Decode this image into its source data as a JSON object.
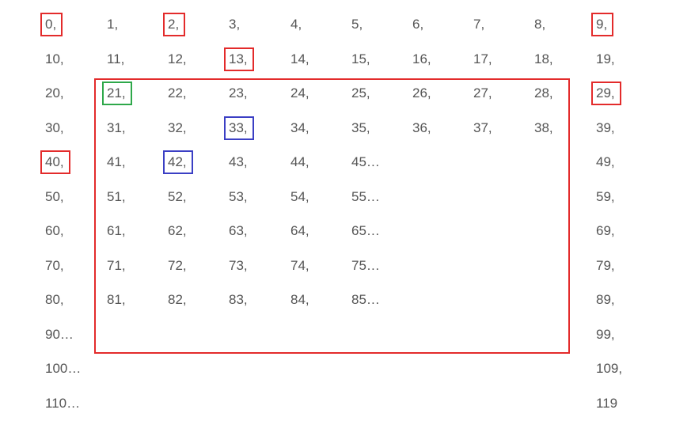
{
  "colors": {
    "text": "#555555",
    "red": "#e32b2b",
    "green": "#2ea84a",
    "blue": "#3b3fc4"
  },
  "rows": [
    {
      "cells": [
        {
          "col": 0,
          "text": "0,"
        },
        {
          "col": 1,
          "text": "1,"
        },
        {
          "col": 2,
          "text": "2,"
        },
        {
          "col": 3,
          "text": "3,"
        },
        {
          "col": 4,
          "text": "4,"
        },
        {
          "col": 5,
          "text": "5,"
        },
        {
          "col": 6,
          "text": "6,"
        },
        {
          "col": 7,
          "text": "7,"
        },
        {
          "col": 8,
          "text": "8,"
        },
        {
          "col": 9,
          "text": "9,"
        }
      ]
    },
    {
      "cells": [
        {
          "col": 0,
          "text": "10,"
        },
        {
          "col": 1,
          "text": "11,"
        },
        {
          "col": 2,
          "text": "12,"
        },
        {
          "col": 3,
          "text": "13,"
        },
        {
          "col": 4,
          "text": "14,"
        },
        {
          "col": 5,
          "text": "15,"
        },
        {
          "col": 6,
          "text": "16,"
        },
        {
          "col": 7,
          "text": "17,"
        },
        {
          "col": 8,
          "text": "18,"
        },
        {
          "col": 9,
          "text": "19,"
        }
      ]
    },
    {
      "cells": [
        {
          "col": 0,
          "text": "20,"
        },
        {
          "col": 1,
          "text": "21,"
        },
        {
          "col": 2,
          "text": "22,"
        },
        {
          "col": 3,
          "text": "23,"
        },
        {
          "col": 4,
          "text": "24,"
        },
        {
          "col": 5,
          "text": "25,"
        },
        {
          "col": 6,
          "text": "26,"
        },
        {
          "col": 7,
          "text": "27,"
        },
        {
          "col": 8,
          "text": "28,"
        },
        {
          "col": 9,
          "text": "29,"
        }
      ]
    },
    {
      "cells": [
        {
          "col": 0,
          "text": "30,"
        },
        {
          "col": 1,
          "text": "31,"
        },
        {
          "col": 2,
          "text": "32,"
        },
        {
          "col": 3,
          "text": "33,"
        },
        {
          "col": 4,
          "text": "34,"
        },
        {
          "col": 5,
          "text": "35,"
        },
        {
          "col": 6,
          "text": "36,"
        },
        {
          "col": 7,
          "text": "37,"
        },
        {
          "col": 8,
          "text": "38,"
        },
        {
          "col": 9,
          "text": "39,"
        }
      ]
    },
    {
      "cells": [
        {
          "col": 0,
          "text": "40,"
        },
        {
          "col": 1,
          "text": "41,"
        },
        {
          "col": 2,
          "text": "42,"
        },
        {
          "col": 3,
          "text": "43,"
        },
        {
          "col": 4,
          "text": "44,"
        },
        {
          "col": 5,
          "text": "45…"
        },
        {
          "col": 9,
          "text": "49,"
        }
      ]
    },
    {
      "cells": [
        {
          "col": 0,
          "text": "50,"
        },
        {
          "col": 1,
          "text": "51,"
        },
        {
          "col": 2,
          "text": "52,"
        },
        {
          "col": 3,
          "text": "53,"
        },
        {
          "col": 4,
          "text": "54,"
        },
        {
          "col": 5,
          "text": "55…"
        },
        {
          "col": 9,
          "text": "59,"
        }
      ]
    },
    {
      "cells": [
        {
          "col": 0,
          "text": "60,"
        },
        {
          "col": 1,
          "text": "61,"
        },
        {
          "col": 2,
          "text": "62,"
        },
        {
          "col": 3,
          "text": "63,"
        },
        {
          "col": 4,
          "text": "64,"
        },
        {
          "col": 5,
          "text": "65…"
        },
        {
          "col": 9,
          "text": "69,"
        }
      ]
    },
    {
      "cells": [
        {
          "col": 0,
          "text": "70,"
        },
        {
          "col": 1,
          "text": "71,"
        },
        {
          "col": 2,
          "text": "72,"
        },
        {
          "col": 3,
          "text": "73,"
        },
        {
          "col": 4,
          "text": "74,"
        },
        {
          "col": 5,
          "text": "75…"
        },
        {
          "col": 9,
          "text": "79,"
        }
      ]
    },
    {
      "cells": [
        {
          "col": 0,
          "text": "80,"
        },
        {
          "col": 1,
          "text": "81,"
        },
        {
          "col": 2,
          "text": "82,"
        },
        {
          "col": 3,
          "text": "83,"
        },
        {
          "col": 4,
          "text": "84,"
        },
        {
          "col": 5,
          "text": "85…"
        },
        {
          "col": 9,
          "text": "89,"
        }
      ]
    },
    {
      "cells": [
        {
          "col": 0,
          "text": "90…"
        },
        {
          "col": 9,
          "text": "99,"
        }
      ]
    },
    {
      "cells": [
        {
          "col": 0,
          "text": "100…"
        },
        {
          "col": 9,
          "text": "109,"
        }
      ]
    },
    {
      "cells": [
        {
          "col": 0,
          "text": "110…"
        },
        {
          "col": 9,
          "text": "119"
        }
      ]
    }
  ],
  "highlights": [
    {
      "row": 0,
      "col": 0,
      "color": "red"
    },
    {
      "row": 0,
      "col": 2,
      "color": "red"
    },
    {
      "row": 0,
      "col": 9,
      "color": "red"
    },
    {
      "row": 1,
      "col": 3,
      "color": "red"
    },
    {
      "row": 2,
      "col": 1,
      "color": "green"
    },
    {
      "row": 2,
      "col": 9,
      "color": "red"
    },
    {
      "row": 3,
      "col": 3,
      "color": "blue"
    },
    {
      "row": 4,
      "col": 0,
      "color": "red"
    },
    {
      "row": 4,
      "col": 2,
      "color": "blue"
    }
  ],
  "region": {
    "row_start": 2,
    "row_end": 9,
    "col_start": 1,
    "col_end": 8,
    "color": "red"
  }
}
